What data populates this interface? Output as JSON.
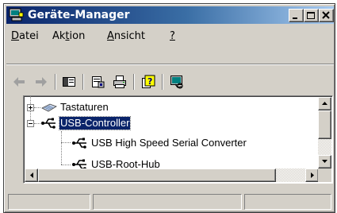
{
  "window": {
    "title": "Geräte-Manager"
  },
  "title_buttons": {
    "minimize": "minimize",
    "maximize": "maximize",
    "close": "close"
  },
  "menu": [
    {
      "label": "Datei",
      "accel": "D"
    },
    {
      "label": "Aktion",
      "accel": "t"
    },
    {
      "label": "Ansicht",
      "accel": "A"
    },
    {
      "label": "?",
      "accel": "?"
    }
  ],
  "toolbar": [
    "back-arrow-icon",
    "forward-arrow-icon",
    "console-tree-icon",
    "properties-icon",
    "print-icon",
    "help-icon",
    "scan-hardware-icon"
  ],
  "tree": {
    "items": [
      {
        "label": "Tastaturen",
        "icon": "keyboard-icon",
        "expander": "plus"
      },
      {
        "label": "USB-Controller",
        "icon": "usb-icon",
        "expander": "minus",
        "selected": true
      },
      {
        "label": "USB High Speed Serial Converter",
        "icon": "usb-icon"
      },
      {
        "label": "USB-Root-Hub",
        "icon": "usb-icon"
      }
    ]
  },
  "status": [
    "",
    "",
    ""
  ],
  "colors": {
    "title_start": "#0a246a",
    "title_end": "#a6caf0",
    "selection": "#0a246a",
    "face": "#d4d0c8"
  }
}
